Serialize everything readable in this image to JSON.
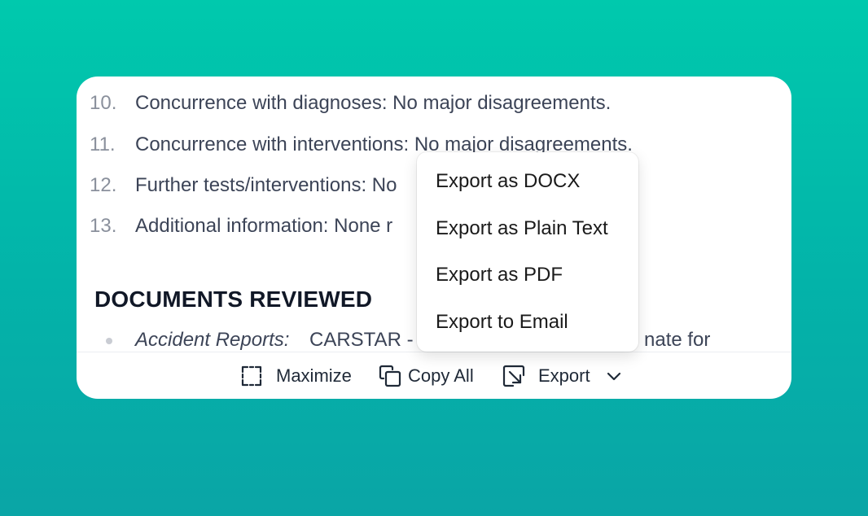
{
  "document": {
    "numbered_items": [
      {
        "number": "10.",
        "text": "Concurrence with diagnoses: No major disagreements."
      },
      {
        "number": "11.",
        "text": "Concurrence with interventions: No major disagreements."
      },
      {
        "number": "12.",
        "text": "Further tests/interventions: No"
      },
      {
        "number": "13.",
        "text": "Additional information: None r"
      }
    ],
    "section_heading": "DOCUMENTS REVIEWED",
    "bullet_items": [
      {
        "label": "Accident Reports:",
        "text": "CARSTAR -",
        "trailing_text": "nate for"
      }
    ]
  },
  "toolbar": {
    "maximize_label": "Maximize",
    "copy_all_label": "Copy All",
    "export_label": "Export"
  },
  "export_menu": {
    "items": [
      "Export as DOCX",
      "Export as Plain Text",
      "Export as PDF",
      "Export to Email"
    ]
  },
  "icons": {
    "maximize": "maximize-icon",
    "copy": "copy-icon",
    "export": "export-icon",
    "dropdown": "chevron-down-icon"
  },
  "colors": {
    "background_gradient_top": "#00c9ad",
    "background_gradient_bottom": "#0aa5a6",
    "card": "#ffffff",
    "heading": "#111827",
    "body_text": "#3c4457",
    "list_number": "#8a909c"
  }
}
